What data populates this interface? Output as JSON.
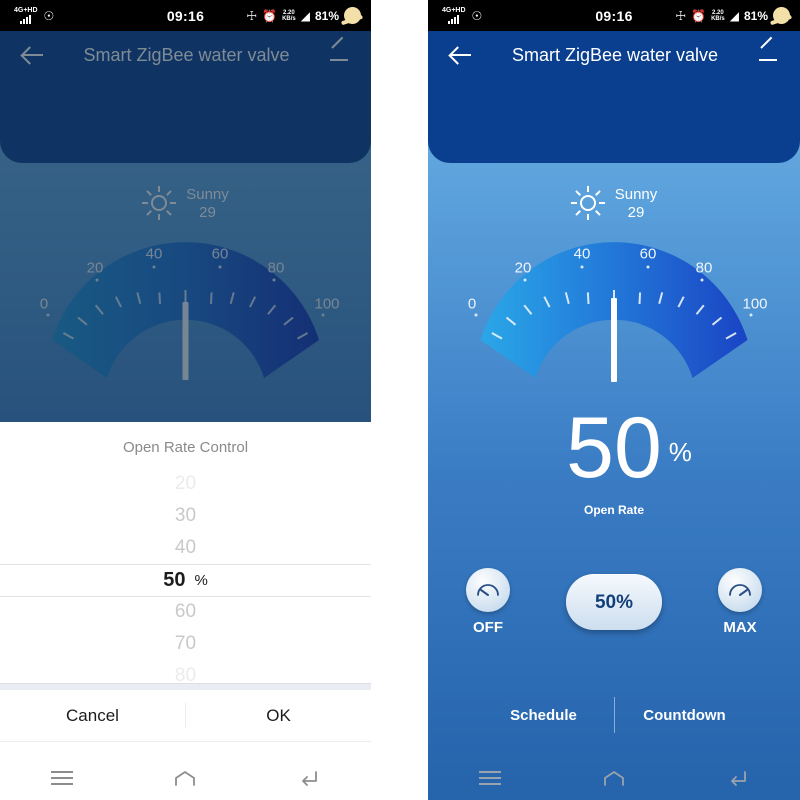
{
  "status_bar": {
    "network_type": "4G+HD",
    "music_icon": "music-app-icon",
    "time": "09:16",
    "bluetooth_icon": "bluetooth-icon",
    "alarm_icon": "alarm-icon",
    "speed_value": "2.20",
    "speed_unit": "KB/s",
    "wifi_icon": "wifi-icon",
    "battery": "81%",
    "moon_icon": "moon-icon"
  },
  "header": {
    "back_icon": "back-arrow-icon",
    "title": "Smart ZigBee water valve",
    "edit_icon": "pencil-edit-icon"
  },
  "weather": {
    "icon": "sun-icon",
    "condition": "Sunny",
    "temperature": "29"
  },
  "gauge": {
    "tick_labels": [
      "0",
      "20",
      "40",
      "60",
      "80",
      "100"
    ],
    "min": 0,
    "max": 100,
    "value": 50,
    "pointer_color": "#ffffff"
  },
  "readout": {
    "value": "50",
    "unit": "%",
    "label": "Open Rate"
  },
  "controls": {
    "off_label": "OFF",
    "off_icon": "gauge-min-icon",
    "center_value": "50%",
    "max_label": "MAX",
    "max_icon": "gauge-max-icon"
  },
  "tabs": [
    {
      "label": "Schedule",
      "name": "tab-schedule"
    },
    {
      "label": "Countdown",
      "name": "tab-countdown"
    }
  ],
  "dialog": {
    "title": "Open Rate Control",
    "options": [
      "20",
      "30",
      "40",
      "50",
      "60",
      "70",
      "80"
    ],
    "selected": "50",
    "unit": "%",
    "cancel_label": "Cancel",
    "ok_label": "OK"
  },
  "navbar": {
    "menu_icon": "menu-icon",
    "home_icon": "home-icon",
    "back_icon": "back-icon"
  },
  "colors": {
    "header_blue": "#0a3f8f",
    "body_top": "#74b3e3",
    "body_bottom": "#2563ab",
    "accent_white": "#ffffff"
  }
}
